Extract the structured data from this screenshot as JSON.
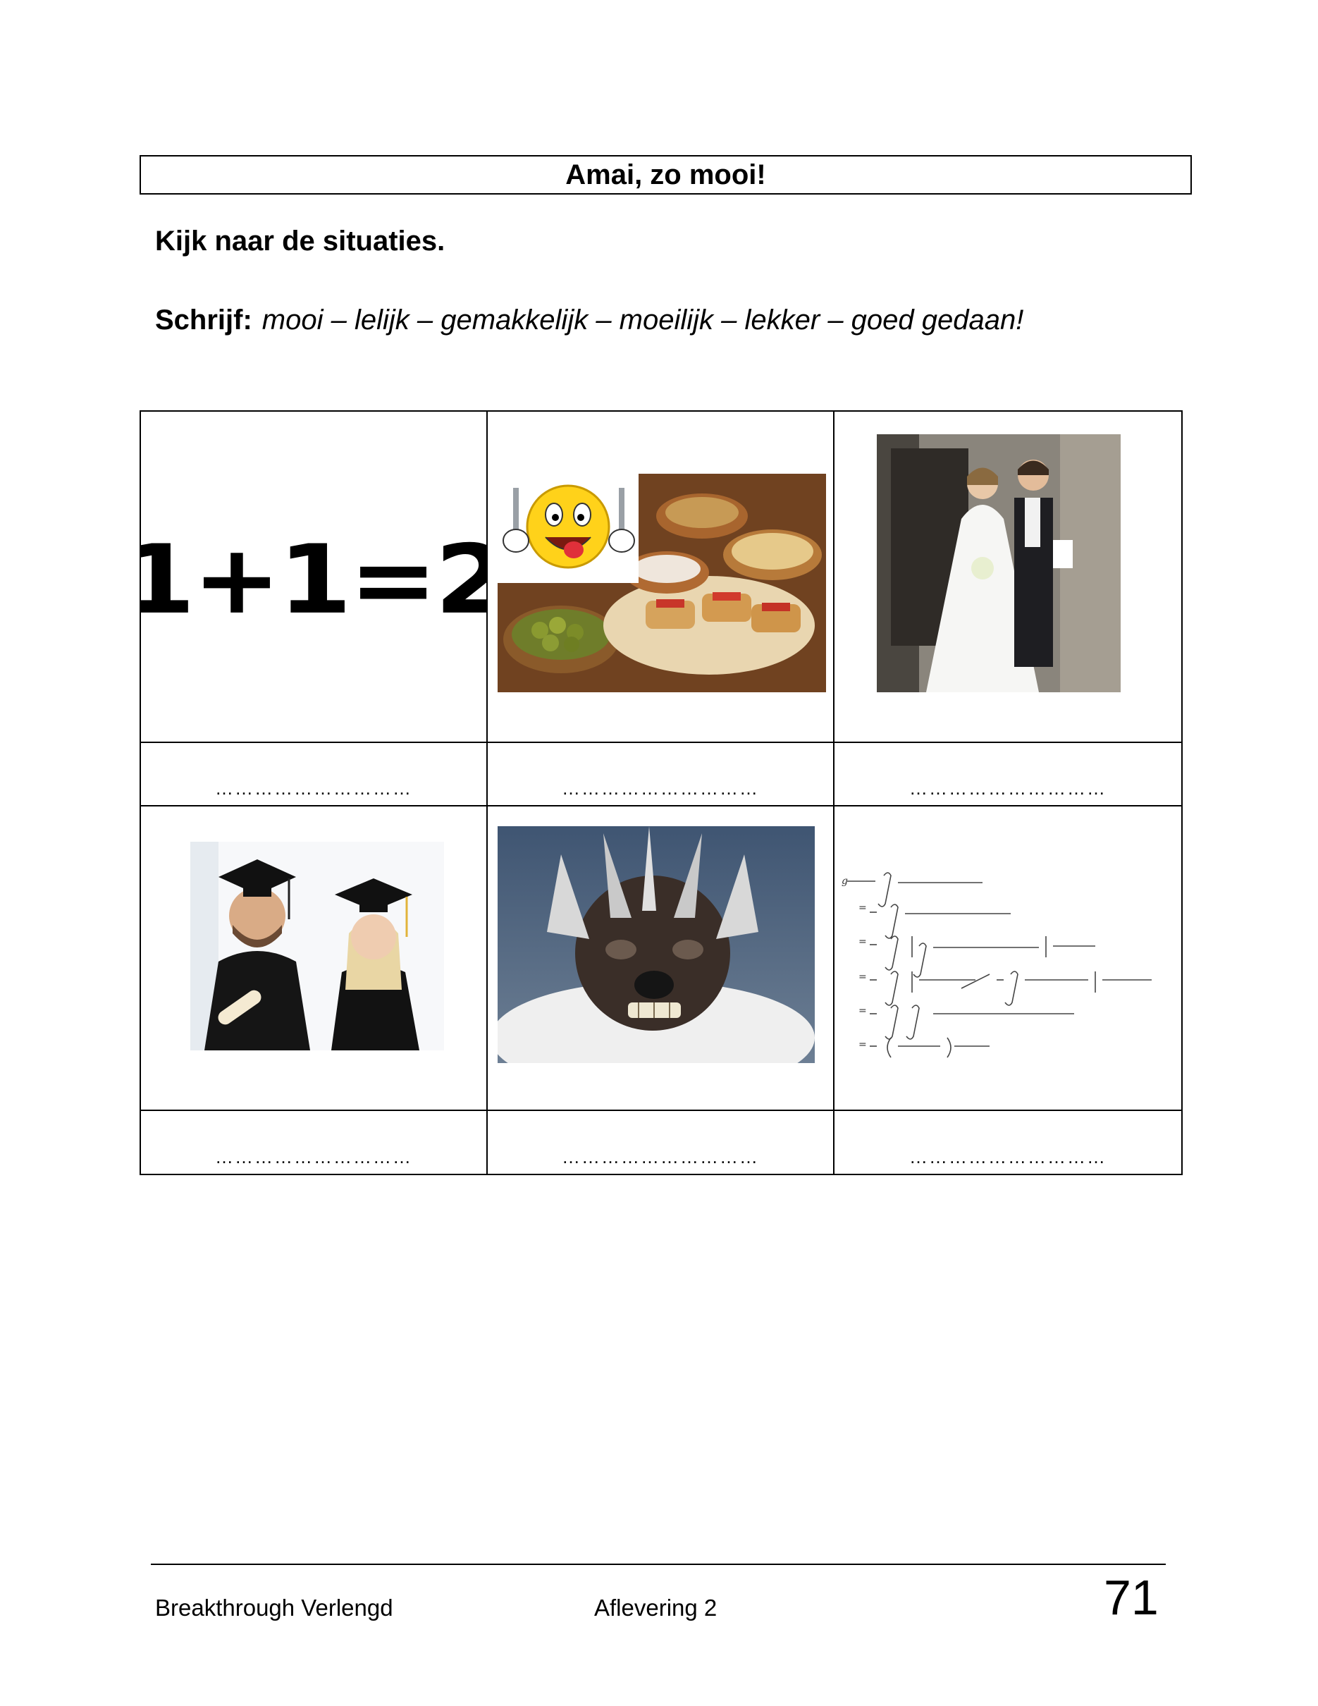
{
  "title": "Amai, zo mooi!",
  "instruction": "Kijk naar de situaties.",
  "write_label": "Schrijf:",
  "word_list": "mooi – lelijk – gemakkelijk – moeilijk – lekker – goed gedaan!",
  "math_text": "1+1=2",
  "answer_blank": "…………………………",
  "footer": {
    "left": "Breakthrough Verlengd",
    "middle": "Aflevering 2",
    "page_number": "71"
  }
}
